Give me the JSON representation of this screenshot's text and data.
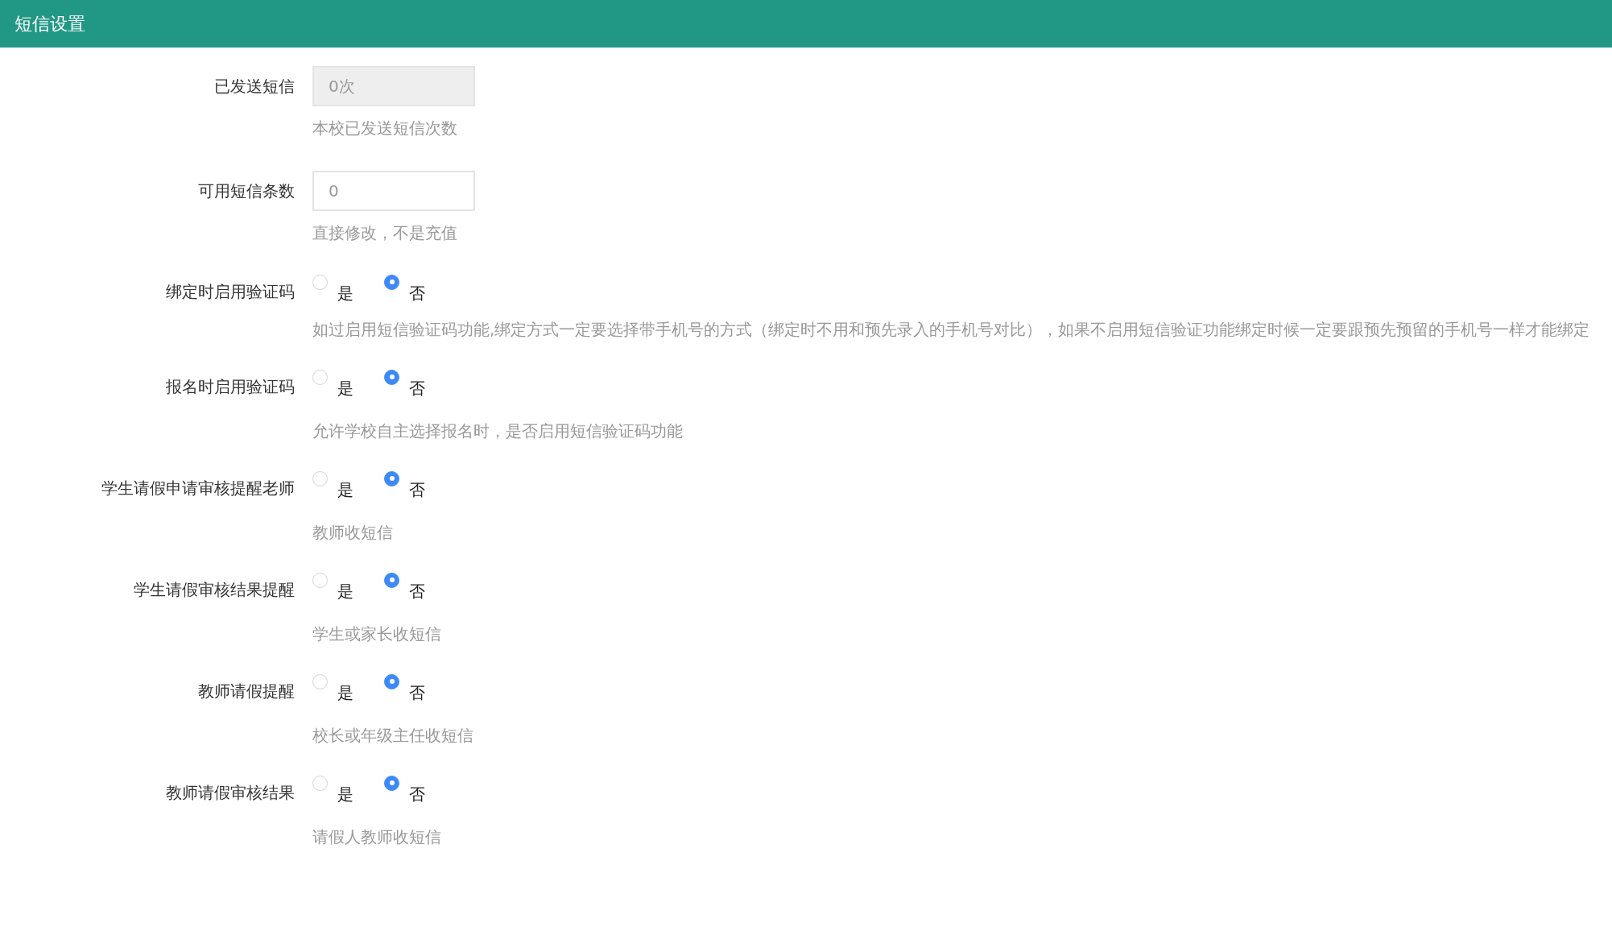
{
  "header": {
    "title": "短信设置"
  },
  "fields": [
    {
      "kind": "input",
      "label": "已发送短信",
      "value": "0次",
      "disabled": true,
      "hint": "本校已发送短信次数"
    },
    {
      "kind": "input",
      "label": "可用短信条数",
      "placeholder": "0",
      "disabled": false,
      "hint": "直接修改，不是充值"
    },
    {
      "kind": "radio",
      "label": "绑定时启用验证码",
      "options": [
        {
          "label": "是",
          "selected": false
        },
        {
          "label": "否",
          "selected": true
        }
      ],
      "hint": "如过启用短信验证码功能,绑定方式一定要选择带手机号的方式（绑定时不用和预先录入的手机号对比），如果不启用短信验证功能绑定时候一定要跟预先预留的手机号一样才能绑定"
    },
    {
      "kind": "radio",
      "label": "报名时启用验证码",
      "options": [
        {
          "label": "是",
          "selected": false
        },
        {
          "label": "否",
          "selected": true
        }
      ],
      "hint": "允许学校自主选择报名时，是否启用短信验证码功能"
    },
    {
      "kind": "radio",
      "label": "学生请假申请审核提醒老师",
      "options": [
        {
          "label": "是",
          "selected": false
        },
        {
          "label": "否",
          "selected": true
        }
      ],
      "hint": "教师收短信"
    },
    {
      "kind": "radio",
      "label": "学生请假审核结果提醒",
      "options": [
        {
          "label": "是",
          "selected": false
        },
        {
          "label": "否",
          "selected": true
        }
      ],
      "hint": "学生或家长收短信"
    },
    {
      "kind": "radio",
      "label": "教师请假提醒",
      "options": [
        {
          "label": "是",
          "selected": false
        },
        {
          "label": "否",
          "selected": true
        }
      ],
      "hint": "校长或年级主任收短信"
    },
    {
      "kind": "radio",
      "label": "教师请假审核结果",
      "options": [
        {
          "label": "是",
          "selected": false
        },
        {
          "label": "否",
          "selected": true
        }
      ],
      "hint": "请假人教师收短信"
    }
  ]
}
